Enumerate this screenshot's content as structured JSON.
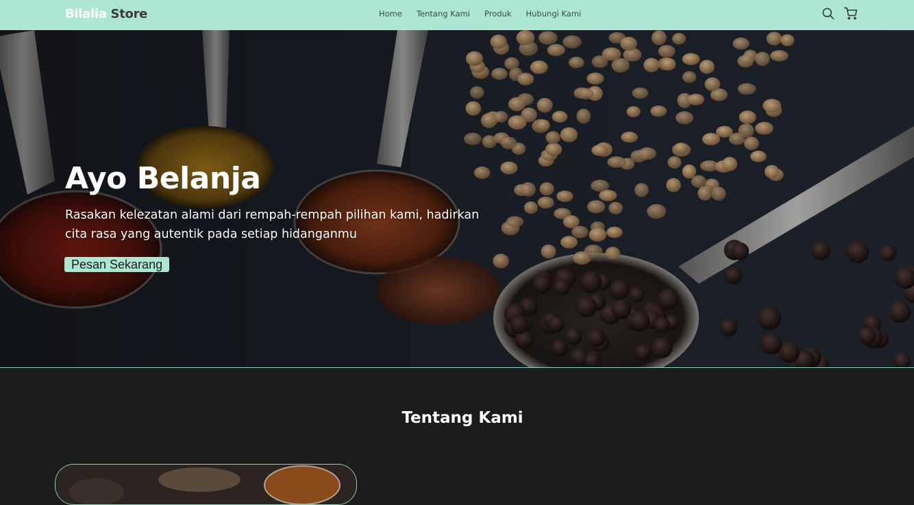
{
  "navbar": {
    "brand_part1": "Bilalia",
    "brand_part2": " Store",
    "links": [
      "Home",
      "Tentang Kami",
      "Produk",
      "Hubungi Kami"
    ],
    "icons": [
      "search-icon",
      "cart-icon"
    ],
    "background": "#ade7d4"
  },
  "hero": {
    "title": "Ayo Belanja",
    "subtitle": "Rasakan kelezatan alami dari rempah-rempah pilihan kami, hadirkan cita rasa yang autentik pada setiap hidanganmu",
    "cta_label": "Pesan Sekarang"
  },
  "about": {
    "title": "Tentang Kami"
  },
  "colors": {
    "accent": "#ade7d4",
    "dark_bg": "#1c1c1c",
    "text_light": "#ffffff"
  }
}
